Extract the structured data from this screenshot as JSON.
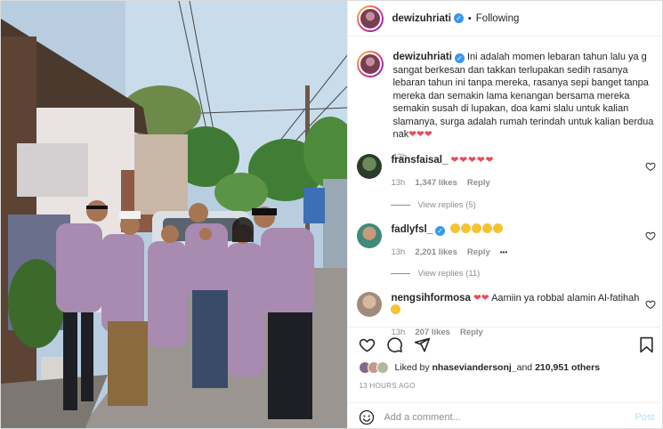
{
  "post": {
    "username": "dewizuhriati",
    "follow_label": "Following",
    "caption": "Ini adalah momen lebaran tahun lalu ya g sangat berkesan dan takkan terlupakan sedih rasanya lebaran tahun ini tanpa mereka, rasanya sepi banget tanpa mereka dan semakin lama kenangan bersama mereka semakin susah di lupakan, doa kami slalu untuk kalian slamanya, surga adalah rumah terindah untuk kalian berdua nak",
    "caption_emoji": "❤❤❤",
    "caption_time": "13h"
  },
  "comments": [
    {
      "username": "fransfaisal_",
      "text": "❤❤❤❤❤",
      "time": "13h",
      "likes": "1,347 likes",
      "reply_label": "Reply",
      "view_replies": "View replies (5)"
    },
    {
      "username": "fadlyfsl_",
      "text": "",
      "emoji_count": 5,
      "time": "13h",
      "likes": "2,201 likes",
      "reply_label": "Reply",
      "more": "•••",
      "view_replies": "View replies (11)"
    },
    {
      "username": "nengsihformosa",
      "text_prefix": "❤❤",
      "text": "Aamiin ya robbal alamin Al-fatihah",
      "time": "13h",
      "likes": "207 likes",
      "reply_label": "Reply"
    }
  ],
  "likes": {
    "prefix": "Liked by ",
    "user": "nhaseviandersonj_",
    "middle": " and ",
    "count": "210,951 others"
  },
  "posted_ago": "13 HOURS AGO",
  "add_comment": {
    "placeholder": "Add a comment...",
    "post_label": "Post"
  },
  "icons": {
    "like": "heart-outline-icon",
    "comment": "comment-bubble-icon",
    "share": "paper-plane-icon",
    "save": "bookmark-icon",
    "emoji": "smiley-icon",
    "verified": "verified-badge-icon"
  },
  "colors": {
    "heart_red": "#ed4956",
    "verified_blue": "#3897f0",
    "secondary_text": "#8e8e8e",
    "post_disabled": "#b2dffc"
  }
}
